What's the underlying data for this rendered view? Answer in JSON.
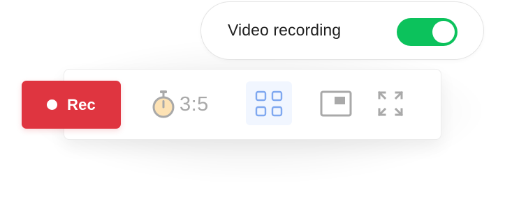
{
  "toggle": {
    "label": "Video recording",
    "enabled": true,
    "on_color": "#0cc25c"
  },
  "toolbar": {
    "rec_label": "Rec",
    "rec_color": "#df3540",
    "timer_value": "3:5",
    "icons": {
      "record": "record-dot-icon",
      "timer": "stopwatch-icon",
      "layout": "grid-layout-icon",
      "pip": "picture-in-picture-icon",
      "fullscreen": "fullscreen-expand-icon"
    },
    "active_tool": "grid-layout",
    "active_accent": "#7fa8f0"
  }
}
